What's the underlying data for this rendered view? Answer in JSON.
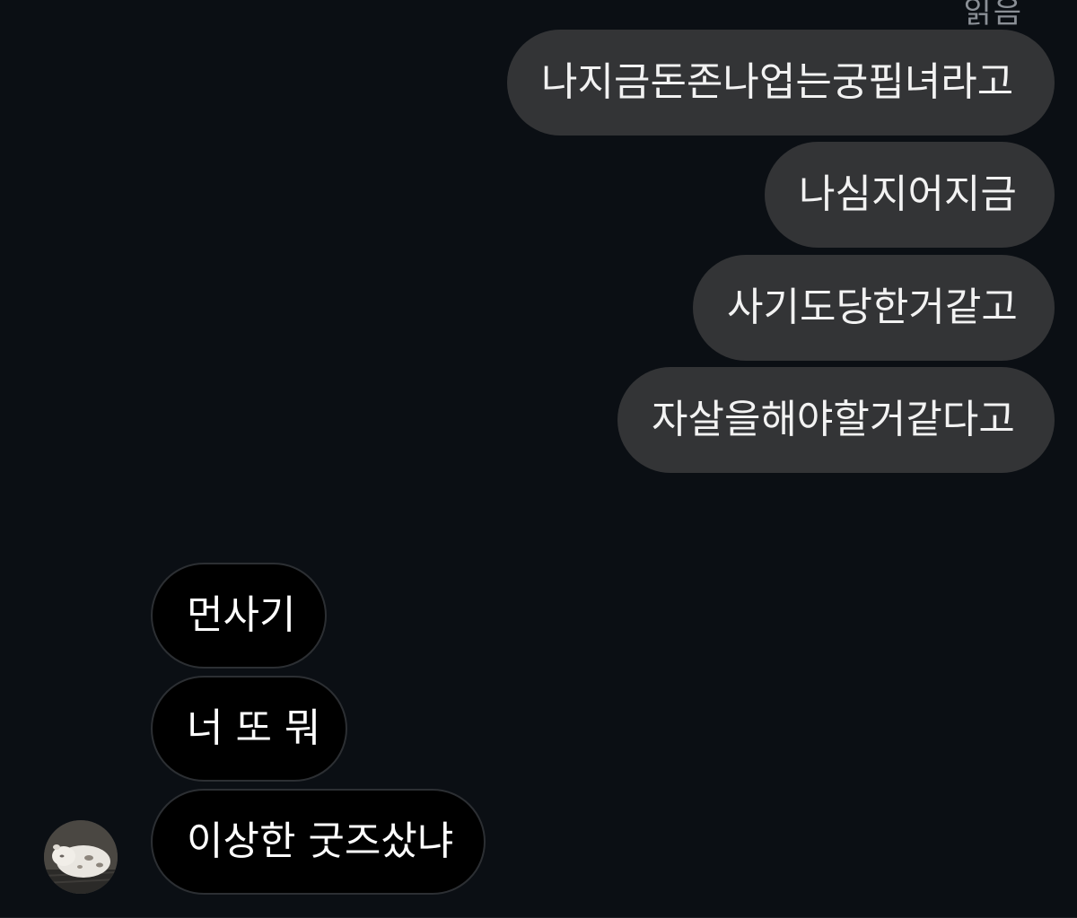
{
  "header": {
    "cut_off_text": "읽음"
  },
  "messages": {
    "outgoing": [
      {
        "text": "나지금돈존나업는궁핍녀라고"
      },
      {
        "text": "나심지어지금"
      },
      {
        "text": "사기도당한거같고"
      },
      {
        "text": "자살을해야할거같다고"
      }
    ],
    "incoming": [
      {
        "text": "먼사기"
      },
      {
        "text": "너 또 뭐"
      },
      {
        "text": "이상한 굿즈샀냐"
      }
    ]
  },
  "avatar": {
    "icon": "cat-photo-avatar"
  },
  "colors": {
    "background": "#0b0f14",
    "outgoing_bubble": "#333436",
    "incoming_bubble": "#000000",
    "incoming_border": "#2c2f33"
  }
}
